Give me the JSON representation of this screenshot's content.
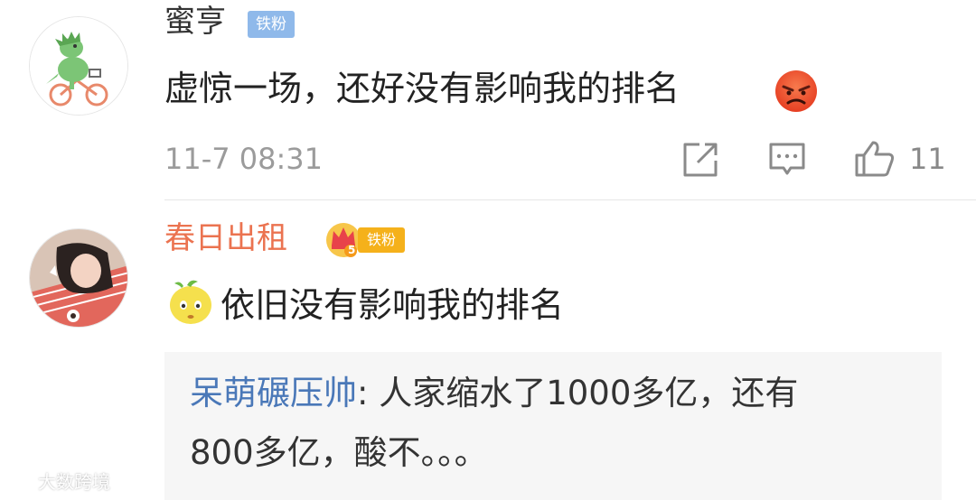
{
  "comments": [
    {
      "username": "蜜亨",
      "badge": "铁粉",
      "text": "虚惊一场，还好没有影响我的排名",
      "emoji": "angry-face-emoji",
      "timestamp": "11-7 08:31",
      "like_count": "11"
    },
    {
      "username": "春日出租",
      "badge": "铁粉",
      "vip_level": "5",
      "emoji": "sour-lemon-emoji",
      "text": "依旧没有影响我的排名",
      "reply": {
        "author": "呆萌碾压帅",
        "line1": ": 人家缩水了1000多亿，还有",
        "line2": "800多亿，酸不。。。"
      }
    }
  ],
  "icons": {
    "share": "share-icon",
    "reply": "comment-icon",
    "like": "thumbs-up-icon"
  },
  "watermark": "大数跨境",
  "colors": {
    "username_vip": "#eb7350",
    "badge_blue": "#8fb9ea",
    "badge_gold": "#f5b11b",
    "reply_author": "#4a78b8",
    "meta_gray": "#9b9b9b"
  }
}
